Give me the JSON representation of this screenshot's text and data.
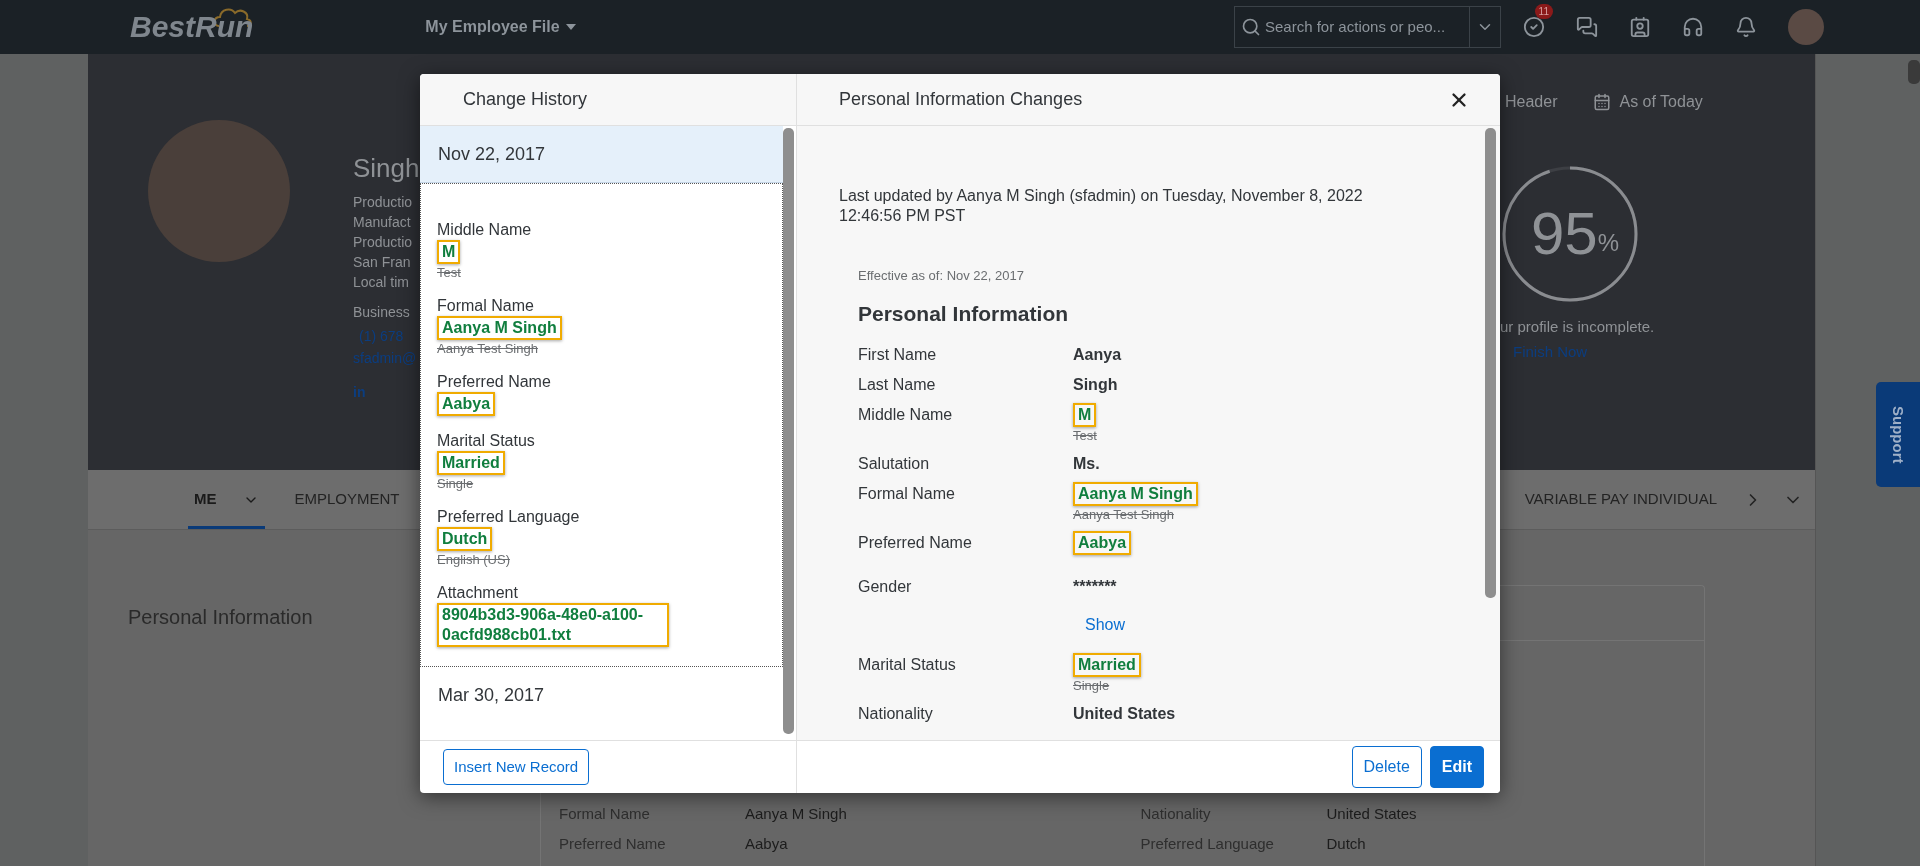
{
  "topbar": {
    "logo": "BestRun",
    "menu": "My Employee File",
    "search": {
      "placeholder": "Search for actions or peo..."
    },
    "notification_count": "11"
  },
  "profile": {
    "name": "Singh",
    "lines": [
      "Productio",
      "Manufact",
      "Productio",
      "San Fran",
      "Local tim"
    ],
    "business_label": "Business",
    "phone": "(1) 678",
    "email": "sfadmin@",
    "social": "in",
    "header_toggle": "Header",
    "as_of": "As of Today",
    "completion": {
      "value": "95",
      "unit": "%",
      "level": 0.95,
      "message": "ur profile is incomplete.",
      "link": "Finish Now"
    }
  },
  "tabs": [
    {
      "label": "ME",
      "selected": true,
      "has_menu": true
    },
    {
      "label": "EMPLOYMENT",
      "selected": false,
      "has_menu": false
    },
    {
      "label": "VARIABLE PAY INDIVIDUAL",
      "selected": false,
      "has_menu": false
    }
  ],
  "section": {
    "title": "Personal Information",
    "columns": [
      [
        {
          "label": "Formal Name",
          "value": "Aanya M Singh"
        },
        {
          "label": "Preferred Name",
          "value": "Aabya"
        }
      ],
      [
        {
          "label": "Nationality",
          "value": "United States"
        },
        {
          "label": "Preferred Language",
          "value": "Dutch"
        }
      ]
    ]
  },
  "support": "Support",
  "dialog": {
    "history_title": "Change History",
    "history": [
      {
        "date": "Nov 22, 2017",
        "selected": true,
        "expanded": true,
        "changes": [
          {
            "label": "Middle Name",
            "new": "M",
            "old": "Test"
          },
          {
            "label": "Formal Name",
            "new": "Aanya M Singh",
            "old": "Aanya Test Singh"
          },
          {
            "label": "Preferred Name",
            "new": "Aabya"
          },
          {
            "label": "Marital Status",
            "new": "Married",
            "old": "Single"
          },
          {
            "label": "Preferred Language",
            "new": "Dutch",
            "old": "English (US)"
          },
          {
            "label": "Attachment",
            "new": "8904b3d3-906a-48e0-a100-0acfd988cb01.txt"
          }
        ]
      },
      {
        "date": "Mar 30, 2017",
        "selected": false,
        "expanded": false
      }
    ],
    "insert_button": "Insert New Record",
    "title": "Personal Information Changes",
    "updated": "Last updated by Aanya M Singh (sfadmin) on Tuesday, November 8, 2022 12:46:56 PM PST",
    "effective": "Effective as of: Nov 22, 2017",
    "heading": "Personal Information",
    "fields": [
      {
        "label": "First Name",
        "value": "Aanya",
        "changed": false
      },
      {
        "label": "Last Name",
        "value": "Singh",
        "changed": false
      },
      {
        "label": "Middle Name",
        "value": "M",
        "changed": true,
        "old": "Test"
      },
      {
        "label": "Salutation",
        "value": "Ms.",
        "changed": false
      },
      {
        "label": "Formal Name",
        "value": "Aanya M Singh",
        "changed": true,
        "old": "Aanya Test Singh"
      },
      {
        "label": "Preferred Name",
        "value": "Aabya",
        "changed": true
      },
      {
        "label": "Gender",
        "value": "*******",
        "changed": false,
        "link": "Show"
      },
      {
        "label": "Marital Status",
        "value": "Married",
        "changed": true,
        "old": "Single"
      },
      {
        "label": "Nationality",
        "value": "United States",
        "changed": false
      }
    ],
    "buttons": [
      {
        "label": "Delete",
        "kind": "secondary"
      },
      {
        "label": "Edit",
        "kind": "primary"
      }
    ]
  }
}
